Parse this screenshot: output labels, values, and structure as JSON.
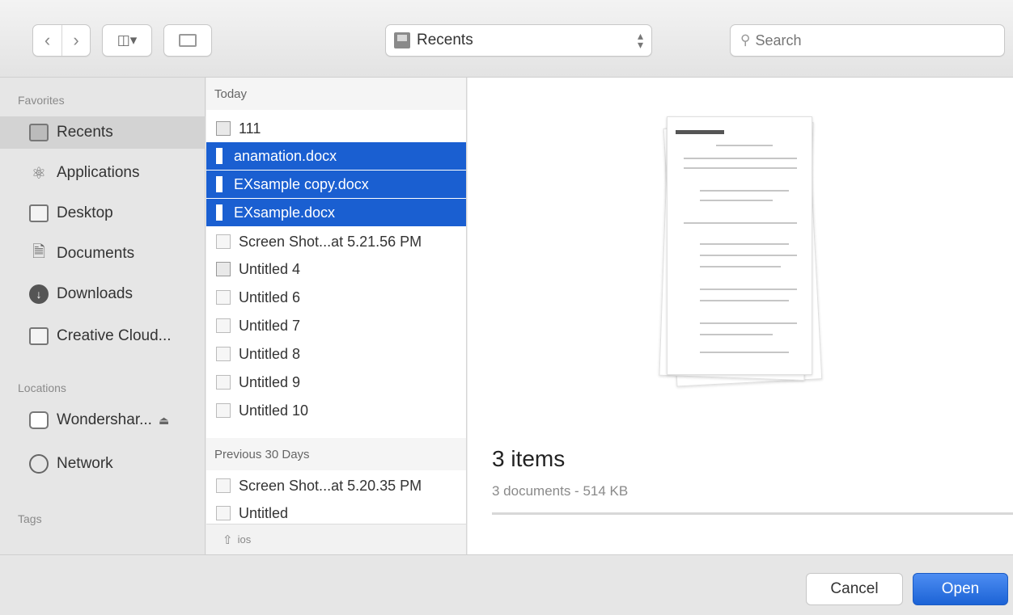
{
  "toolbar": {
    "back_icon": "chevron-left-icon",
    "forward_icon": "chevron-right-icon",
    "view_icon": "column-view-icon",
    "view_label": "◫▾",
    "location_label": "Recents",
    "search_placeholder": "Search"
  },
  "sidebar": {
    "favorites_heading": "Favorites",
    "favorites": [
      {
        "label": "Recents",
        "icon": "recents-icon"
      },
      {
        "label": "Applications",
        "icon": "applications-icon"
      },
      {
        "label": "Desktop",
        "icon": "desktop-icon"
      },
      {
        "label": "Documents",
        "icon": "documents-icon"
      },
      {
        "label": "Downloads",
        "icon": "downloads-icon"
      },
      {
        "label": "Creative Cloud...",
        "icon": "folder-icon"
      }
    ],
    "locations_heading": "Locations",
    "locations": [
      {
        "label": "Wondershar...",
        "icon": "drive-icon"
      },
      {
        "label": "Network",
        "icon": "network-icon"
      }
    ],
    "tags_heading": "Tags"
  },
  "filelist": {
    "today_heading": "Today",
    "today_items": [
      {
        "name": "111"
      },
      {
        "name": "anamation.docx"
      },
      {
        "name": "EXsample copy.docx"
      },
      {
        "name": "EXsample.docx"
      },
      {
        "name": "Screen Shot...at 5.21.56 PM"
      },
      {
        "name": "Untitled 4"
      },
      {
        "name": "Untitled 6"
      },
      {
        "name": "Untitled 7"
      },
      {
        "name": "Untitled 8"
      },
      {
        "name": "Untitled 9"
      },
      {
        "name": "Untitled 10"
      }
    ],
    "previous_heading": "Previous 30 Days",
    "previous_items": [
      {
        "name": "Screen Shot...at 5.20.35 PM"
      },
      {
        "name": "Untitled"
      }
    ],
    "footer_label": "ios"
  },
  "preview": {
    "title": "3 items",
    "subtitle": "3 documents - 514 KB"
  },
  "buttons": {
    "cancel": "Cancel",
    "open": "Open"
  },
  "colors": {
    "selection": "#1a5fd1",
    "primary_button": "#1c63d6"
  }
}
